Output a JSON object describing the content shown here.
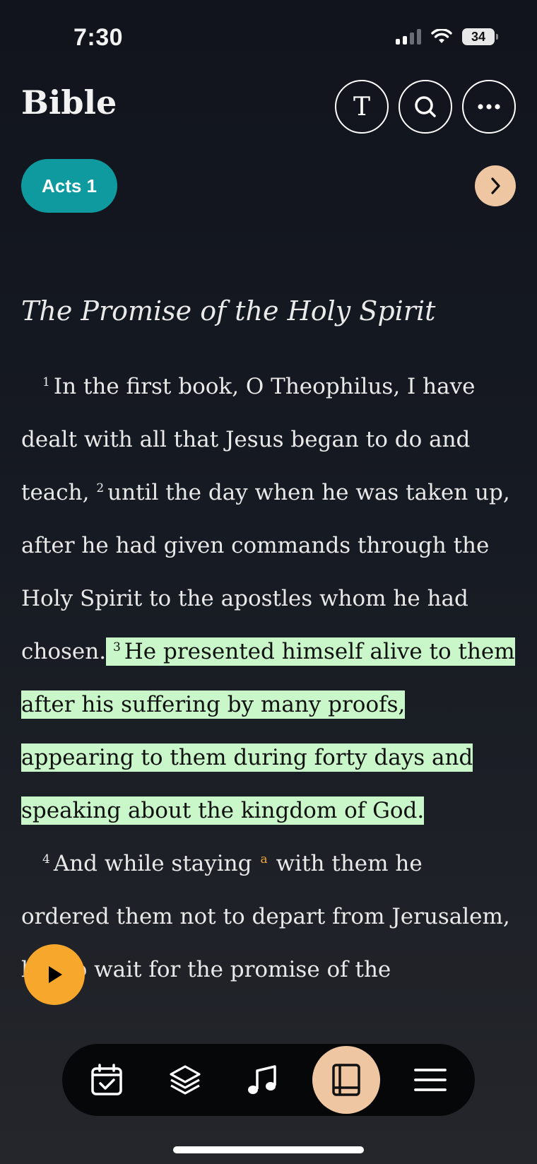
{
  "status_bar": {
    "time": "7:30",
    "battery": "34"
  },
  "header": {
    "title": "Bible",
    "buttons": [
      {
        "icon": "text-settings-icon",
        "glyph": "T"
      },
      {
        "icon": "search-icon"
      },
      {
        "icon": "more-icon"
      }
    ]
  },
  "chapter": {
    "label": "Acts 1"
  },
  "passage": {
    "heading": "The Promise of the Holy Spirit",
    "verses": [
      {
        "num": "1",
        "text": "In the first book, O Theophilus, I have dealt with all that Jesus began to do and teach,"
      },
      {
        "num": "2",
        "text": "until the day when he was taken up, after he had given commands through the Holy Spirit to the apostles whom he had chosen."
      },
      {
        "num": "3",
        "text": "He presented himself alive to them after his suffering by many proofs, appearing to them during forty days and speaking about the kingdom of God.",
        "highlighted": true
      },
      {
        "num": "4",
        "text_before_note": "And while staying",
        "footnote": "a",
        "text_after_note": "with them he ordered them not to depart from Jerusalem, but to wait for the promise of the"
      }
    ]
  },
  "bottom_nav": {
    "items": [
      {
        "icon": "calendar-check-icon"
      },
      {
        "icon": "layers-icon"
      },
      {
        "icon": "music-note-icon"
      },
      {
        "icon": "book-icon",
        "active": true
      },
      {
        "icon": "menu-icon"
      }
    ]
  },
  "colors": {
    "accent_teal": "#0f9aa0",
    "accent_peach": "#efc6a2",
    "highlight_green": "#c9f7c9",
    "play_orange": "#f7a72c"
  }
}
